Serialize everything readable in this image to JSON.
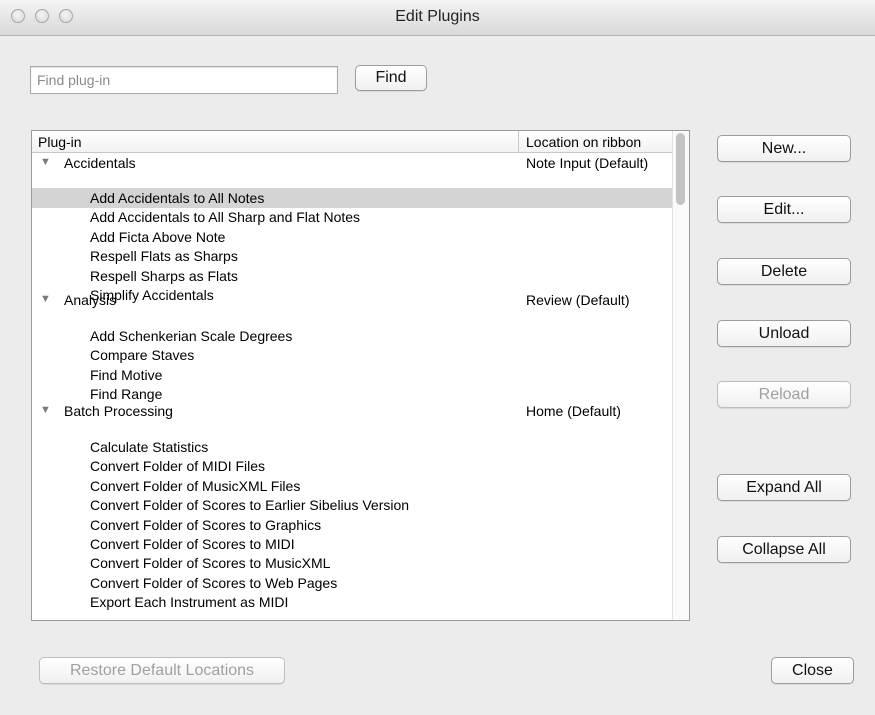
{
  "window": {
    "title": "Edit Plugins"
  },
  "search": {
    "placeholder": "Find plug-in",
    "value": "",
    "button": "Find"
  },
  "table": {
    "columns": [
      "Plug-in",
      "Location on ribbon"
    ],
    "groups": [
      {
        "name": "Accidentals",
        "location": "Note Input (Default)",
        "items": [
          "Add Accidentals to All Notes",
          "Add Accidentals to All Sharp and Flat Notes",
          "Add Ficta Above Note",
          "Respell Flats as Sharps",
          "Respell Sharps as Flats",
          "Simplify Accidentals"
        ]
      },
      {
        "name": "Analysis",
        "location": "Review (Default)",
        "items": [
          "Add Schenkerian Scale Degrees",
          "Compare Staves",
          "Find Motive",
          "Find Range"
        ]
      },
      {
        "name": "Batch Processing",
        "location": "Home (Default)",
        "items": [
          "Calculate Statistics",
          "Convert Folder of MIDI Files",
          "Convert Folder of MusicXML Files",
          "Convert Folder of Scores to Earlier Sibelius Version",
          "Convert Folder of Scores to Graphics",
          "Convert Folder of Scores to MIDI",
          "Convert Folder of Scores to MusicXML",
          "Convert Folder of Scores to Web Pages",
          "Export Each Instrument as MIDI"
        ]
      }
    ],
    "selected_item": "Add Accidentals to All Notes"
  },
  "side_buttons": {
    "new": "New...",
    "edit": "Edit...",
    "delete": "Delete",
    "unload": "Unload",
    "reload": "Reload",
    "expand_all": "Expand All",
    "collapse_all": "Collapse All"
  },
  "bottom": {
    "restore": "Restore Default Locations",
    "close": "Close"
  }
}
